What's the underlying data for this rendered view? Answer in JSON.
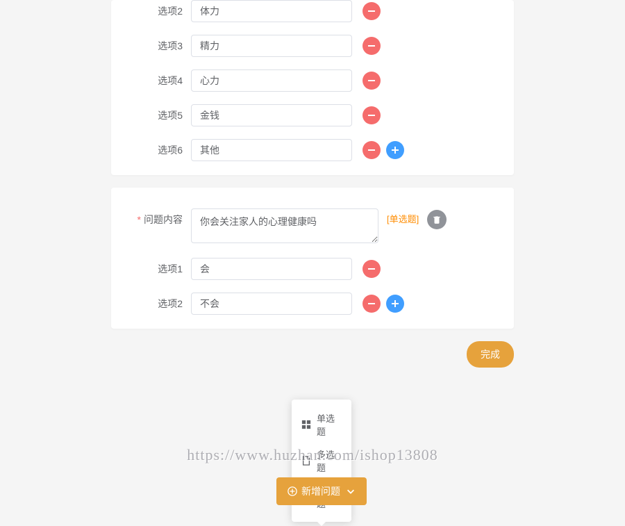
{
  "q1": {
    "options": [
      {
        "label": "选项2",
        "value": "体力"
      },
      {
        "label": "选项3",
        "value": "精力"
      },
      {
        "label": "选项4",
        "value": "心力"
      },
      {
        "label": "选项5",
        "value": "金钱"
      },
      {
        "label": "选项6",
        "value": "其他"
      }
    ]
  },
  "q2": {
    "content_label": "问题内容",
    "content_value": "你会关注家人的心理健康吗",
    "type_tag": "[单选题]",
    "options": [
      {
        "label": "选项1",
        "value": "会"
      },
      {
        "label": "选项2",
        "value": "不会"
      }
    ]
  },
  "footer": {
    "finish": "完成"
  },
  "popover": {
    "items": [
      {
        "name": "single",
        "label": "单选题"
      },
      {
        "name": "multi",
        "label": "多选题"
      },
      {
        "name": "essay",
        "label": "简答题"
      }
    ]
  },
  "add_button": "新增问题",
  "watermark": "https://www.huzhan.com/ishop13808"
}
